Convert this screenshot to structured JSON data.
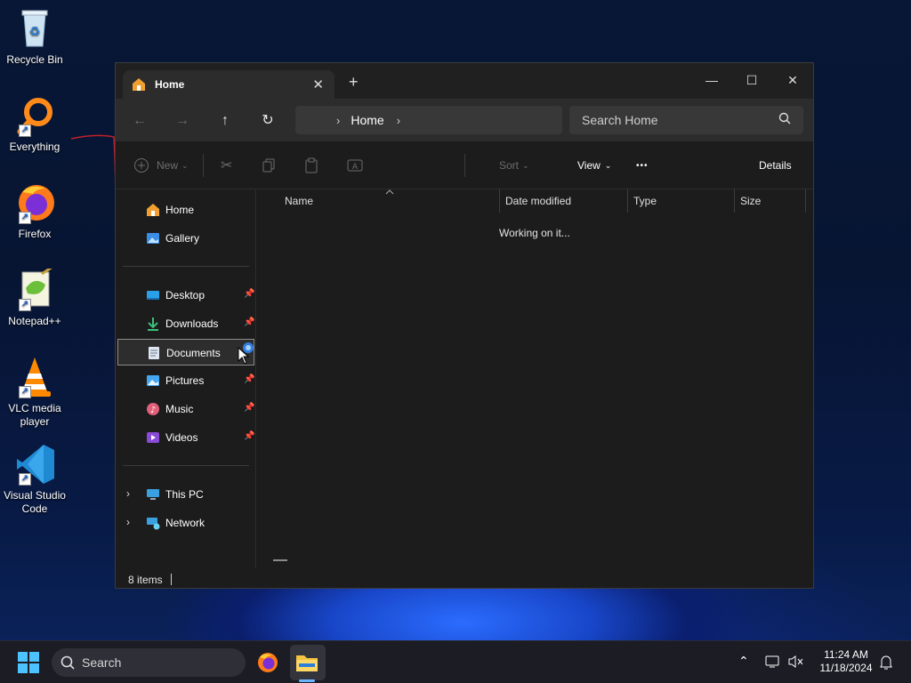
{
  "desktop": {
    "icons": [
      {
        "label": "Recycle Bin"
      },
      {
        "label": "Everything"
      },
      {
        "label": "Firefox"
      },
      {
        "label": "Notepad++"
      },
      {
        "label": "VLC media player"
      },
      {
        "label": "Visual Studio Code"
      }
    ]
  },
  "window": {
    "tab_title": "Home",
    "tab_close": "✕",
    "new_tab": "+",
    "controls": {
      "minimize": "—",
      "maximize": "☐",
      "close": "✕"
    }
  },
  "navbar": {
    "breadcrumb": "Home",
    "search_placeholder": "Search Home"
  },
  "toolbar": {
    "new_label": "New",
    "sort_label": "Sort",
    "view_label": "View",
    "more_label": "•••",
    "details_label": "Details"
  },
  "sidebar": {
    "items": [
      {
        "label": "Home"
      },
      {
        "label": "Gallery"
      },
      {
        "label": "Desktop"
      },
      {
        "label": "Downloads"
      },
      {
        "label": "Documents"
      },
      {
        "label": "Pictures"
      },
      {
        "label": "Music"
      },
      {
        "label": "Videos"
      },
      {
        "label": "This PC"
      },
      {
        "label": "Network"
      }
    ]
  },
  "content": {
    "columns": [
      "Name",
      "Date modified",
      "Type",
      "Size"
    ],
    "loading_text": "Working on it..."
  },
  "statusbar": {
    "items_count": "8 items"
  },
  "taskbar": {
    "search_label": "Search",
    "time": "11:24 AM",
    "date": "11/18/2024"
  },
  "colors": {
    "window_bg": "#1c1c1c",
    "navbar_bg": "#2c2c2c",
    "accent": "#6ab4ff"
  }
}
